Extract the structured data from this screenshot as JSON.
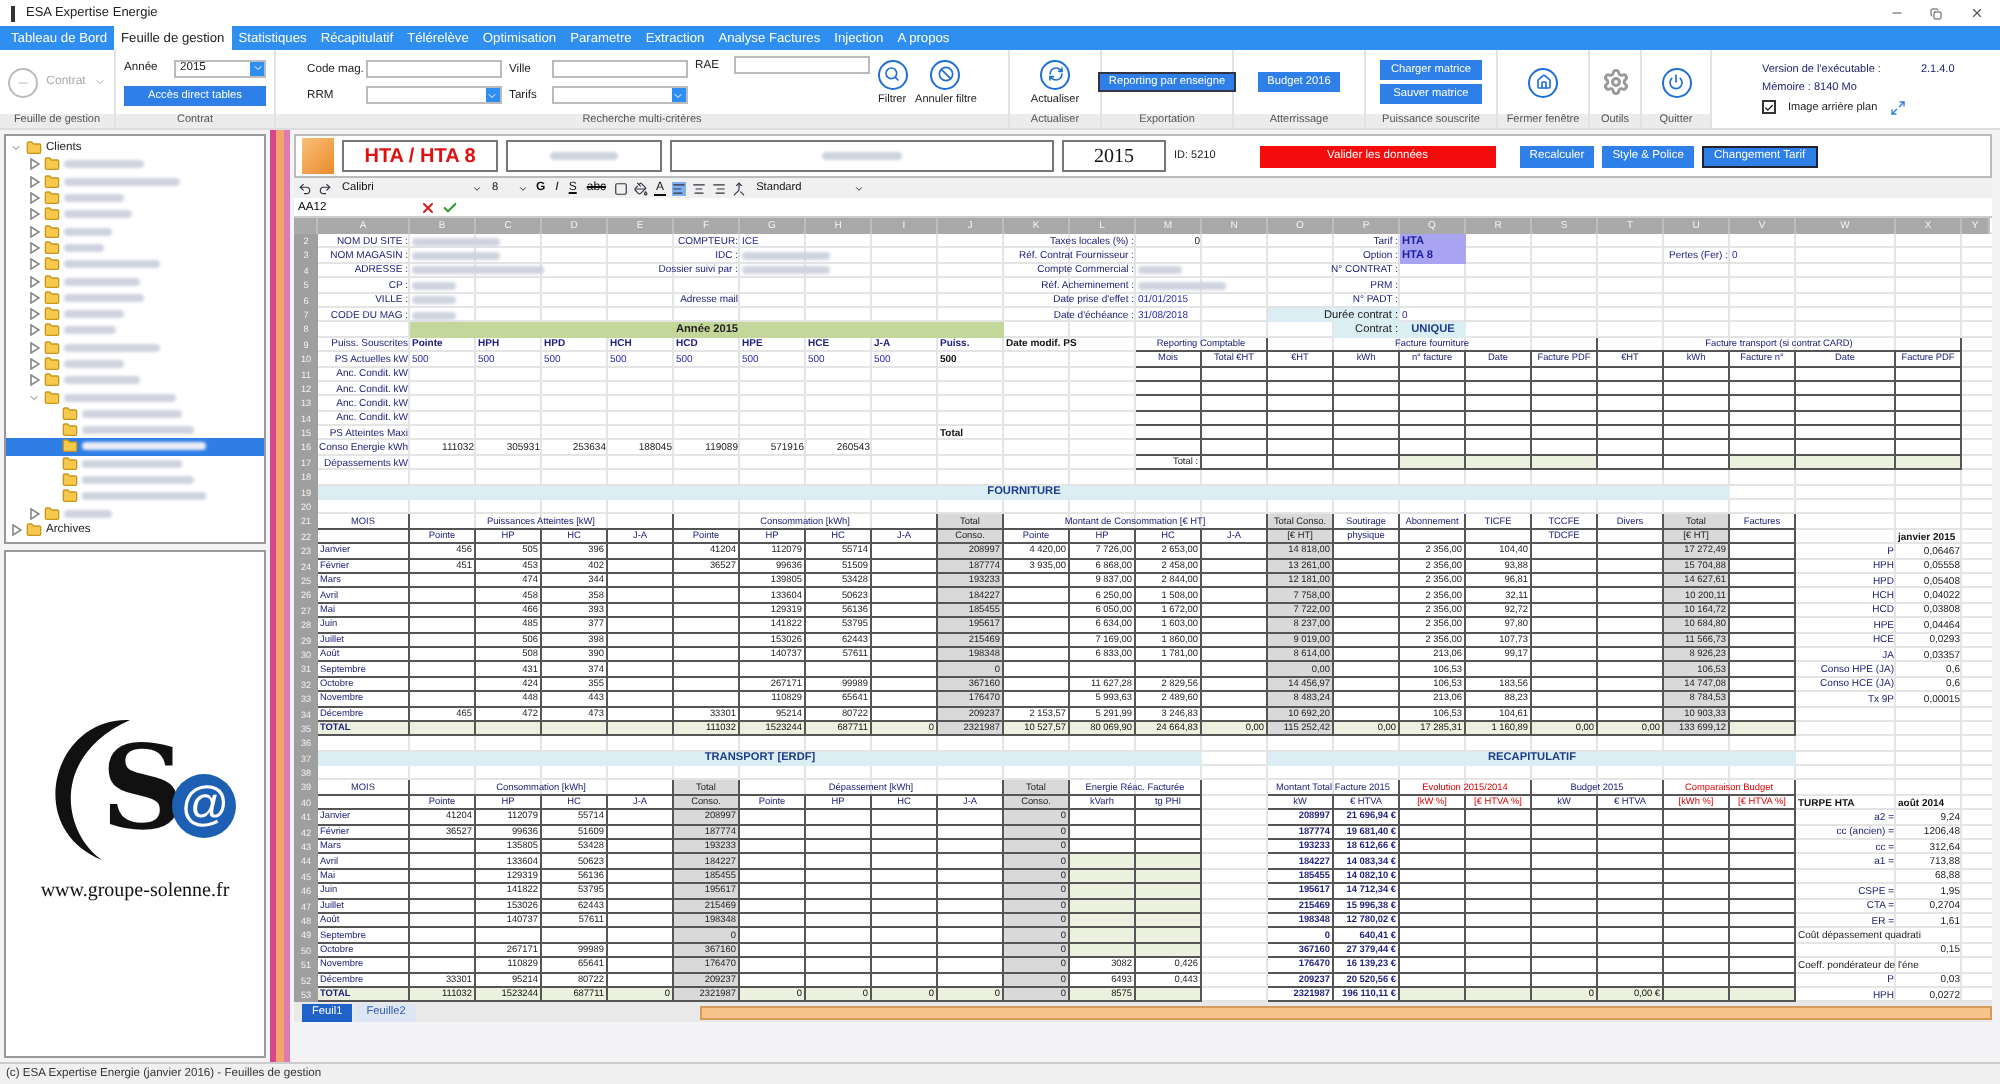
{
  "window": {
    "title": "ESA Expertise Energie"
  },
  "menu": [
    {
      "label": "Tableau de Bord",
      "selected": false
    },
    {
      "label": "Feuille de gestion",
      "selected": true
    },
    {
      "label": "Statistiques",
      "selected": false
    },
    {
      "label": "Récapitulatif",
      "selected": false
    },
    {
      "label": "Télérelève",
      "selected": false
    },
    {
      "label": "Optimisation",
      "selected": false
    },
    {
      "label": "Parametre",
      "selected": false
    },
    {
      "label": "Extraction",
      "selected": false
    },
    {
      "label": "Analyse Factures",
      "selected": false
    },
    {
      "label": "Injection",
      "selected": false
    },
    {
      "label": "A propos",
      "selected": false
    }
  ],
  "ribbon": {
    "groups": [
      {
        "label": "Feuille de gestion",
        "kind": "contract",
        "button": "Contrat",
        "disabled": true
      },
      {
        "label": "Contrat",
        "kind": "year",
        "field": {
          "label": "Année",
          "value": "2015"
        },
        "button": "Accès direct tables"
      },
      {
        "label": "Recherche multi-critères",
        "kind": "search",
        "fields": [
          {
            "label": "Code mag.",
            "kind": "text"
          },
          {
            "label": "RRM",
            "kind": "select"
          },
          {
            "label": "Ville",
            "kind": "text"
          },
          {
            "label": "Tarifs",
            "kind": "select"
          },
          {
            "label": "RAE",
            "kind": "text"
          }
        ],
        "buttons": [
          {
            "label": "Filtrer",
            "kind": "filter"
          },
          {
            "label": "Annuler filtre",
            "kind": "cancel-filter"
          }
        ]
      },
      {
        "label": "Actualiser",
        "kind": "icons",
        "buttons": [
          {
            "label": "Actualiser",
            "kind": "refresh"
          }
        ]
      },
      {
        "label": "Exportation",
        "kind": "texts",
        "buttons": [
          "Reporting par enseigne"
        ]
      },
      {
        "label": "Atterrissage",
        "kind": "texts",
        "buttons": [
          "Budget 2016"
        ]
      },
      {
        "label": "Puissance souscrite",
        "kind": "texts",
        "buttons": [
          "Charger matrice",
          "Sauver matrice"
        ]
      },
      {
        "label": "Fermer fenêtre",
        "kind": "icons",
        "buttons": [
          {
            "kind": "close-window"
          }
        ]
      },
      {
        "label": "Outils",
        "kind": "icons",
        "buttons": [
          {
            "kind": "tools"
          }
        ]
      },
      {
        "label": "Quitter",
        "kind": "icons",
        "buttons": [
          {
            "kind": "quit"
          }
        ]
      }
    ],
    "info": {
      "version_label": "Version de l'exécutable :",
      "version": "2.1.4.0",
      "memory": "Mémoire : 8140 Mo",
      "checkbox": {
        "label": "Image arrière plan",
        "checked": true
      }
    }
  },
  "tree": [
    {
      "label": "Clients",
      "expanded": true,
      "selected": false,
      "children": [
        {
          "expanded": false,
          "selected": false
        },
        {
          "expanded": false,
          "selected": false
        },
        {
          "expanded": false,
          "selected": false
        },
        {
          "expanded": false,
          "selected": false
        },
        {
          "expanded": false,
          "selected": false
        },
        {
          "expanded": false,
          "selected": false
        },
        {
          "expanded": false,
          "selected": false
        },
        {
          "expanded": false,
          "selected": false
        },
        {
          "expanded": false,
          "selected": false
        },
        {
          "expanded": false,
          "selected": false
        },
        {
          "expanded": false,
          "selected": false
        },
        {
          "expanded": false,
          "selected": false
        },
        {
          "expanded": false,
          "selected": false
        },
        {
          "expanded": false,
          "selected": false
        },
        {
          "expanded": true,
          "selected": false,
          "children": [
            {
              "selected": false
            },
            {
              "selected": false
            },
            {
              "selected": true
            },
            {
              "selected": false
            },
            {
              "selected": false
            },
            {
              "selected": false
            }
          ]
        },
        {
          "expanded": false,
          "selected": false
        }
      ]
    },
    {
      "label": "Archives",
      "expanded": false,
      "selected": false
    }
  ],
  "logo": {
    "letter": "S",
    "mark": "@",
    "url": "www.groupe-solenne.fr"
  },
  "sheet_header": {
    "fields": [
      {
        "kind": "title",
        "text": "HTA / HTA 8"
      },
      {
        "kind": "redacted"
      },
      {
        "kind": "redacted-wide"
      },
      {
        "kind": "year",
        "text": "2015"
      }
    ],
    "id": "ID: 5210",
    "buttons": [
      {
        "label": "Valider les données",
        "kind": "danger"
      },
      {
        "label": "Recalculer",
        "kind": "primary"
      },
      {
        "label": "Style & Police",
        "kind": "primary"
      },
      {
        "label": "Changement Tarif",
        "kind": "outlined"
      }
    ]
  },
  "format_bar": {
    "font": "Calibri",
    "size": "8",
    "bold": "G",
    "italic": "I",
    "underline": "S",
    "strike": "abc",
    "font_color": "A",
    "number_format": "Standard",
    "cell_ref": "AA12"
  },
  "columns": [
    "A",
    "B",
    "C",
    "D",
    "E",
    "F",
    "G",
    "H",
    "I",
    "J",
    "K",
    "L",
    "M",
    "N",
    "O",
    "P",
    "Q",
    "R",
    "S",
    "T",
    "U",
    "V",
    "W",
    "X",
    "Y"
  ],
  "rows": [
    {
      "n": "2",
      "cells": {
        "A": {
          "text": "NOM DU SITE :",
          "kind": "label"
        },
        "B-C": {
          "kind": "redacted"
        },
        "F": {
          "text": "COMPTEUR:",
          "kind": "label"
        },
        "G": {
          "text": "ICE",
          "kind": "value"
        },
        "K-L": {
          "text": "Taxes locales (%) :",
          "kind": "label"
        },
        "M": {
          "text": "0",
          "kind": "num"
        },
        "P": {
          "text": "Tarif :",
          "kind": "label"
        },
        "Q": {
          "text": "HTA",
          "kind": "highlight"
        }
      }
    },
    {
      "n": "3",
      "cells": {
        "A": {
          "text": "NOM MAGASIN :",
          "kind": "label"
        },
        "B-C": {
          "kind": "redacted"
        },
        "F": {
          "text": "IDC :",
          "kind": "label"
        },
        "G-H": {
          "kind": "redacted"
        },
        "K-L": {
          "text": "Réf. Contrat Fournisseur :",
          "kind": "label"
        },
        "P": {
          "text": "Option :",
          "kind": "label"
        },
        "Q": {
          "text": "HTA 8",
          "kind": "highlight"
        },
        "T-U": {
          "text": "Pertes (Fer) :",
          "kind": "label"
        },
        "V": {
          "text": "0",
          "kind": "value"
        }
      }
    },
    {
      "n": "4",
      "cells": {
        "A": {
          "text": "ADRESSE :",
          "kind": "label"
        },
        "B-D": {
          "kind": "redacted"
        },
        "E-F": {
          "text": "Dossier suivi par :",
          "kind": "label"
        },
        "G-H": {
          "kind": "redacted"
        },
        "K-L": {
          "text": "Compte Commercial :",
          "kind": "label"
        },
        "M": {
          "kind": "redacted"
        },
        "P": {
          "text": "N° CONTRAT :",
          "kind": "label"
        }
      }
    },
    {
      "n": "5",
      "cells": {
        "A": {
          "text": "CP :",
          "kind": "label"
        },
        "B": {
          "kind": "redacted"
        },
        "K-L": {
          "text": "Réf. Acheminement :",
          "kind": "label"
        },
        "M-N": {
          "kind": "redacted"
        },
        "P": {
          "text": "PRM :",
          "kind": "label"
        }
      }
    },
    {
      "n": "6",
      "cells": {
        "A": {
          "text": "VILLE :",
          "kind": "label"
        },
        "B": {
          "kind": "redacted"
        },
        "F": {
          "text": "Adresse mail",
          "kind": "label"
        },
        "K-L": {
          "text": "Date prise d'effet :",
          "kind": "label"
        },
        "M": {
          "text": "01/01/2015",
          "kind": "value"
        },
        "P": {
          "text": "N° PADT :",
          "kind": "label"
        }
      }
    },
    {
      "n": "7",
      "cells": {
        "A": {
          "text": "CODE DU MAG :",
          "kind": "label"
        },
        "B": {
          "kind": "redacted"
        },
        "K-L": {
          "text": "Date d'échéance :",
          "kind": "label"
        },
        "M": {
          "text": "31/08/2018",
          "kind": "value"
        },
        "O-P": {
          "text": "Durée contrat :",
          "kind": "light"
        },
        "Q": {
          "text": "0",
          "kind": "value"
        }
      }
    },
    {
      "n": "8",
      "cells": {
        "B-J": {
          "text": "Année",
          "year": "2015",
          "kind": "band-green"
        },
        "P": {
          "text": "Contrat :",
          "kind": "light"
        },
        "Q": {
          "text": "UNIQUE",
          "kind": "light-bold"
        }
      }
    },
    {
      "n": "9",
      "kind": "colhead",
      "cells": {
        "A": {
          "text": "Puiss. Souscrites",
          "kind": "label"
        },
        "B": "Pointe",
        "C": "HPH",
        "D": "HPD",
        "E": "HCH",
        "F": "HCD",
        "G": "HPE",
        "H": "HCE",
        "I": "J-A",
        "J": "Puiss.",
        "K-L": {
          "text": "Date modif. PS",
          "kind": "bold"
        },
        "M-N": {
          "text": "Reporting Comptable",
          "kind": "head"
        },
        "O-S": {
          "text": "Facture fourniture",
          "kind": "head"
        },
        "T-X": {
          "text": "Facture transport (si contrat CARD)",
          "kind": "head"
        }
      }
    },
    {
      "n": "10",
      "kind": "head",
      "cells": {
        "A": {
          "text": "PS Actuelles kW",
          "kind": "label"
        },
        "B": {
          "text": "500",
          "kind": "value"
        },
        "C": {
          "text": "500",
          "kind": "value"
        },
        "D": {
          "text": "500",
          "kind": "value"
        },
        "E": {
          "text": "500",
          "kind": "value"
        },
        "F": {
          "text": "500",
          "kind": "value"
        },
        "G": {
          "text": "500",
          "kind": "value"
        },
        "H": {
          "text": "500",
          "kind": "value"
        },
        "I": {
          "text": "500",
          "kind": "value"
        },
        "J": {
          "text": "500",
          "kind": "bold"
        },
        "M": "Mois",
        "N": "Total €HT",
        "O": "€HT",
        "P": "kWh",
        "Q": "n° facture",
        "R": "Date",
        "S": "Facture PDF",
        "T": "€HT",
        "U": "kWh",
        "V": "Facture n°",
        "W": "Date",
        "X": "Facture PDF"
      }
    },
    {
      "n": "11",
      "cells": {
        "A": {
          "text": "Anc. Condit. kW",
          "kind": "label"
        },
        "M-X": {
          "kind": "cell"
        }
      }
    },
    {
      "n": "12",
      "cells": {
        "A": {
          "text": "Anc. Condit. kW",
          "kind": "label"
        },
        "M-X": {
          "kind": "cell"
        }
      }
    },
    {
      "n": "13",
      "cells": {
        "A": {
          "text": "Anc. Condit. kW",
          "kind": "label"
        },
        "M-X": {
          "kind": "cell"
        }
      }
    },
    {
      "n": "14",
      "cells": {
        "A": {
          "text": "Anc. Condit. kW",
          "kind": "label"
        },
        "M-X": {
          "kind": "cell"
        }
      }
    },
    {
      "n": "15",
      "cells": {
        "A": {
          "text": "PS Atteintes Maxi",
          "kind": "label"
        },
        "J": {
          "text": "Total",
          "kind": "bold"
        },
        "M-X": {
          "kind": "cell"
        }
      }
    },
    {
      "n": "16",
      "kind": "num",
      "cells": {
        "A": {
          "text": "Conso Energie kWh",
          "kind": "label"
        },
        "B": "111032",
        "C": "305931",
        "D": "253634",
        "E": "188045",
        "F": "119089",
        "G": "571916",
        "H": "260543",
        "M-X": {
          "kind": "cell"
        }
      }
    },
    {
      "n": "17",
      "cells": {
        "A": {
          "text": "Dépassements kW",
          "kind": "label"
        },
        "M-X": {
          "kind": "cell"
        },
        "Q-S": {
          "kind": "sum"
        },
        "V-X": {
          "kind": "sum"
        },
        "M": {
          "text": "Total :",
          "kind": "cell"
        }
      }
    },
    {
      "n": "18",
      "cells": {}
    },
    {
      "n": "19",
      "cells": {
        "A-U": {
          "text": "FOURNITURE",
          "kind": "band-blue"
        }
      }
    },
    {
      "n": "20",
      "cells": {}
    },
    {
      "n": "21",
      "kind": "head",
      "cells": {
        "A-V": {
          "kind": "head"
        },
        "A": "MOIS",
        "B-E": "Puissances Atteintes [kW]",
        "F-I": "Consommation [kWh]",
        "J": {
          "text": "Total",
          "kind": "head-gray"
        },
        "K-N": "Montant de Consommation [€ HT]",
        "O": {
          "text": "Total Conso.",
          "kind": "head-gray"
        },
        "P": "Soutirage",
        "Q": "Abonnement",
        "R": "TICFE",
        "S": "TCCFE",
        "T": "Divers",
        "U": {
          "text": "Total",
          "kind": "head-gray"
        },
        "V": "Factures"
      }
    },
    {
      "n": "22",
      "kind": "head",
      "cells": {
        "A-V": {
          "kind": "head"
        },
        "B": "Pointe",
        "C": "HP",
        "D": "HC",
        "E": "J-A",
        "F": "Pointe",
        "G": "HP",
        "H": "HC",
        "I": "J-A",
        "J": {
          "text": "Conso.",
          "kind": "head-gray"
        },
        "K": "Pointe",
        "L": "HP",
        "M": "HC",
        "N": "J-A",
        "O": {
          "text": "[€ HT]",
          "kind": "head-gray"
        },
        "P": "physique",
        "S": "TDCFE",
        "U": {
          "text": "[€ HT]",
          "kind": "head-gray"
        },
        "X": {
          "text": "janvier 2015",
          "kind": "bold"
        }
      }
    },
    {
      "n": "23",
      "kind": "cell",
      "cells": {
        "A-V": {
          "kind": "cell"
        },
        "A": {
          "text": "Janvier",
          "kind": "month"
        },
        "B": "456",
        "C": "505",
        "D": "396",
        "F": "41204",
        "G": "112079",
        "H": "55714",
        "J": {
          "text": "208997",
          "kind": "total"
        },
        "K": "4 420,00",
        "L": "7 726,00",
        "M": "2 653,00",
        "O": {
          "text": "14 818,00",
          "kind": "total"
        },
        "Q": "2 356,00",
        "R": "104,40",
        "U": {
          "text": "17 272,49",
          "kind": "total"
        },
        "W": {
          "text": "P",
          "kind": "label"
        },
        "X": {
          "text": "0,06467",
          "kind": "num"
        }
      }
    },
    {
      "n": "24",
      "kind": "cell",
      "cells": {
        "A-V": {
          "kind": "cell"
        },
        "A": {
          "text": "Février",
          "kind": "month"
        },
        "B": "451",
        "C": "453",
        "D": "402",
        "F": "36527",
        "G": "99636",
        "H": "51509",
        "J": {
          "text": "187774",
          "kind": "total"
        },
        "K": "3 935,00",
        "L": "6 868,00",
        "M": "2 458,00",
        "O": {
          "text": "13 261,00",
          "kind": "total"
        },
        "Q": "2 356,00",
        "R": "93,88",
        "U": {
          "text": "15 704,88",
          "kind": "total"
        },
        "W": {
          "text": "HPH",
          "kind": "label"
        },
        "X": {
          "text": "0,05558",
          "kind": "num"
        }
      }
    },
    {
      "n": "25",
      "kind": "cell",
      "cells": {
        "A-V": {
          "kind": "cell"
        },
        "A": {
          "text": "Mars",
          "kind": "month"
        },
        "C": "474",
        "D": "344",
        "G": "139805",
        "H": "53428",
        "J": {
          "text": "193233",
          "kind": "total"
        },
        "L": "9 837,00",
        "M": "2 844,00",
        "O": {
          "text": "12 181,00",
          "kind": "total"
        },
        "Q": "2 356,00",
        "R": "96,81",
        "U": {
          "text": "14 627,61",
          "kind": "total"
        },
        "W": {
          "text": "HPD",
          "kind": "label"
        },
        "X": {
          "text": "0,05408",
          "kind": "num"
        }
      }
    },
    {
      "n": "26",
      "kind": "cell",
      "cells": {
        "A-V": {
          "kind": "cell"
        },
        "A": {
          "text": "Avril",
          "kind": "month"
        },
        "C": "458",
        "D": "358",
        "G": "133604",
        "H": "50623",
        "J": {
          "text": "184227",
          "kind": "total"
        },
        "L": "6 250,00",
        "M": "1 508,00",
        "O": {
          "text": "7 758,00",
          "kind": "total"
        },
        "Q": "2 356,00",
        "R": "32,11",
        "U": {
          "text": "10 200,11",
          "kind": "total"
        },
        "W": {
          "text": "HCH",
          "kind": "label"
        },
        "X": {
          "text": "0,04022",
          "kind": "num"
        }
      }
    },
    {
      "n": "27",
      "kind": "cell",
      "cells": {
        "A-V": {
          "kind": "cell"
        },
        "A": {
          "text": "Mai",
          "kind": "month"
        },
        "C": "466",
        "D": "393",
        "G": "129319",
        "H": "56136",
        "J": {
          "text": "185455",
          "kind": "total"
        },
        "L": "6 050,00",
        "M": "1 672,00",
        "O": {
          "text": "7 722,00",
          "kind": "total"
        },
        "Q": "2 356,00",
        "R": "92,72",
        "U": {
          "text": "10 164,72",
          "kind": "total"
        },
        "W": {
          "text": "HCD",
          "kind": "label"
        },
        "X": {
          "text": "0,03808",
          "kind": "num"
        }
      }
    },
    {
      "n": "28",
      "kind": "cell",
      "cells": {
        "A-V": {
          "kind": "cell"
        },
        "A": {
          "text": "Juin",
          "kind": "month"
        },
        "C": "485",
        "D": "377",
        "G": "141822",
        "H": "53795",
        "J": {
          "text": "195617",
          "kind": "total"
        },
        "L": "6 634,00",
        "M": "1 603,00",
        "O": {
          "text": "8 237,00",
          "kind": "total"
        },
        "Q": "2 356,00",
        "R": "97,80",
        "U": {
          "text": "10 684,80",
          "kind": "total"
        },
        "W": {
          "text": "HPE",
          "kind": "label"
        },
        "X": {
          "text": "0,04464",
          "kind": "num"
        }
      }
    },
    {
      "n": "29",
      "kind": "cell",
      "cells": {
        "A-V": {
          "kind": "cell"
        },
        "A": {
          "text": "Juillet",
          "kind": "month"
        },
        "C": "506",
        "D": "398",
        "G": "153026",
        "H": "62443",
        "J": {
          "text": "215469",
          "kind": "total"
        },
        "L": "7 169,00",
        "M": "1 860,00",
        "O": {
          "text": "9 019,00",
          "kind": "total"
        },
        "Q": "2 356,00",
        "R": "107,73",
        "U": {
          "text": "11 566,73",
          "kind": "total"
        },
        "W": {
          "text": "HCE",
          "kind": "label"
        },
        "X": {
          "text": "0,0293",
          "kind": "num"
        }
      }
    },
    {
      "n": "30",
      "kind": "cell",
      "cells": {
        "A-V": {
          "kind": "cell"
        },
        "A": {
          "text": "Août",
          "kind": "month"
        },
        "C": "508",
        "D": "390",
        "G": "140737",
        "H": "57611",
        "J": {
          "text": "198348",
          "kind": "total"
        },
        "L": "6 833,00",
        "M": "1 781,00",
        "O": {
          "text": "8 614,00",
          "kind": "total"
        },
        "Q": "213,06",
        "R": "99,17",
        "U": {
          "text": "8 926,23",
          "kind": "total"
        },
        "W": {
          "text": "JA",
          "kind": "label"
        },
        "X": {
          "text": "0,03357",
          "kind": "num"
        }
      }
    },
    {
      "n": "31",
      "kind": "cell",
      "cells": {
        "A-V": {
          "kind": "cell"
        },
        "A": {
          "text": "Septembre",
          "kind": "month"
        },
        "C": "431",
        "D": "374",
        "J": {
          "text": "0",
          "kind": "total"
        },
        "O": {
          "text": "0,00",
          "kind": "total"
        },
        "Q": "106,53",
        "U": {
          "text": "106,53",
          "kind": "total"
        },
        "W": {
          "text": "Conso HPE (JA)",
          "kind": "label"
        },
        "X": {
          "text": "0,6",
          "kind": "num"
        }
      }
    },
    {
      "n": "32",
      "kind": "cell",
      "cells": {
        "A-V": {
          "kind": "cell"
        },
        "A": {
          "text": "Octobre",
          "kind": "month"
        },
        "C": "424",
        "D": "355",
        "G": "267171",
        "H": "99989",
        "J": {
          "text": "367160",
          "kind": "total"
        },
        "L": "11 627,28",
        "M": "2 829,56",
        "O": {
          "text": "14 456,97",
          "kind": "total"
        },
        "Q": "106,53",
        "R": "183,56",
        "U": {
          "text": "14 747,08",
          "kind": "total"
        },
        "W": {
          "text": "Conso HCE (JA)",
          "kind": "label"
        },
        "X": {
          "text": "0,6",
          "kind": "num"
        }
      }
    },
    {
      "n": "33",
      "kind": "cell",
      "cells": {
        "A-V": {
          "kind": "cell"
        },
        "A": {
          "text": "Novembre",
          "kind": "month"
        },
        "C": "448",
        "D": "443",
        "G": "110829",
        "H": "65641",
        "J": {
          "text": "176470",
          "kind": "total"
        },
        "L": "5 993,63",
        "M": "2 489,60",
        "O": {
          "text": "8 483,24",
          "kind": "total"
        },
        "Q": "213,06",
        "R": "88,23",
        "U": {
          "text": "8 784,53",
          "kind": "total"
        },
        "W": {
          "text": "Tx 9P",
          "kind": "label"
        },
        "X": {
          "text": "0,00015",
          "kind": "num"
        }
      }
    },
    {
      "n": "34",
      "kind": "cell",
      "cells": {
        "A-V": {
          "kind": "cell"
        },
        "A": {
          "text": "Décembre",
          "kind": "month"
        },
        "B": "465",
        "C": "472",
        "D": "473",
        "F": "33301",
        "G": "95214",
        "H": "80722",
        "J": {
          "text": "209237",
          "kind": "total"
        },
        "K": "2 153,57",
        "L": "5 291,99",
        "M": "3 246,83",
        "O": {
          "text": "10 692,20",
          "kind": "total"
        },
        "Q": "106,53",
        "R": "104,61",
        "U": {
          "text": "10 903,33",
          "kind": "total"
        }
      }
    },
    {
      "n": "35",
      "kind": "sum",
      "cells": {
        "A-V": {
          "kind": "sum"
        },
        "A": {
          "text": "TOTAL",
          "kind": "sum-label"
        },
        "F": "111032",
        "G": "1523244",
        "H": "687711",
        "I": "0",
        "J": {
          "text": "2321987",
          "kind": "total"
        },
        "K": "10 527,57",
        "L": "80 069,90",
        "M": "24 664,83",
        "N": "0,00",
        "O": {
          "text": "115 252,42",
          "kind": "total"
        },
        "P": "0,00",
        "Q": "17 285,31",
        "R": "1 160,89",
        "S": "0,00",
        "T": "0,00",
        "U": {
          "text": "133 699,12",
          "kind": "total"
        }
      }
    },
    {
      "n": "36",
      "cells": {}
    },
    {
      "n": "37",
      "cells": {
        "A-M": {
          "text": "TRANSPORT [ERDF]",
          "kind": "band-blue"
        },
        "O-V": {
          "text": "RECAPITULATIF",
          "kind": "band-blue"
        }
      }
    },
    {
      "n": "38",
      "cells": {}
    },
    {
      "n": "39",
      "kind": "head",
      "cells": {
        "A-M": {
          "kind": "head"
        },
        "O-V": {
          "kind": "head"
        },
        "A": "MOIS",
        "B-E": "Consommation [kWh]",
        "F": {
          "text": "Total",
          "kind": "head-gray"
        },
        "G-J": "Dépassement [kWh]",
        "K": {
          "text": "Total",
          "kind": "head-gray"
        },
        "L-M": "Energie Réac. Facturée",
        "O-P": "Montant Total Facture 2015",
        "Q-R": {
          "text": "Evolution 2015/2014",
          "kind": "head-red"
        },
        "S-T": "Budget 2015",
        "U-V": {
          "text": "Comparaison Budget",
          "kind": "head-red"
        }
      }
    },
    {
      "n": "40",
      "kind": "head",
      "cells": {
        "A-M": {
          "kind": "head"
        },
        "B": "Pointe",
        "C": "HP",
        "D": "HC",
        "E": "J-A",
        "F": {
          "text": "Conso.",
          "kind": "head-gray"
        },
        "G": "Pointe",
        "H": "HP",
        "I": "HC",
        "J": "J-A",
        "K": {
          "text": "Conso.",
          "kind": "head-gray"
        },
        "L": "kVarh",
        "M": "tg PHI",
        "O": "kW",
        "P": "€ HTVA",
        "Q": {
          "text": "[kW %]",
          "kind": "head-red"
        },
        "R": {
          "text": "[€ HTVA %]",
          "kind": "head-red"
        },
        "S": "kW",
        "T": "€ HTVA",
        "U": {
          "text": "[kWh %]",
          "kind": "head-red"
        },
        "V": {
          "text": "[€ HTVA %]",
          "kind": "head-red"
        },
        "W": {
          "text": "TURPE HTA",
          "kind": "bold"
        },
        "X": {
          "text": "août 2014",
          "kind": "bold"
        }
      }
    },
    {
      "n": "41",
      "kind": "cell",
      "cells": {
        "A-M": {
          "kind": "cell"
        },
        "O-V": {
          "kind": "cell"
        },
        "A": {
          "text": "Janvier",
          "kind": "month"
        },
        "B": "41204",
        "C": "112079",
        "D": "55714",
        "F": {
          "text": "208997",
          "kind": "total"
        },
        "K": {
          "text": "0",
          "kind": "total"
        },
        "O": {
          "text": "208997",
          "kind": "cell-bold"
        },
        "P": {
          "text": "21 696,94 €",
          "kind": "cell-bold"
        },
        "W": {
          "text": "a2 =",
          "kind": "label"
        },
        "X": {
          "text": "9,24",
          "kind": "num"
        }
      }
    },
    {
      "n": "42",
      "kind": "cell",
      "cells": {
        "A-M": {
          "kind": "cell"
        },
        "O-V": {
          "kind": "cell"
        },
        "A": {
          "text": "Février",
          "kind": "month"
        },
        "B": "36527",
        "C": "99636",
        "D": "51609",
        "F": {
          "text": "187774",
          "kind": "total"
        },
        "K": {
          "text": "0",
          "kind": "total"
        },
        "O": {
          "text": "187774",
          "kind": "cell-bold"
        },
        "P": {
          "text": "19 681,40 €",
          "kind": "cell-bold"
        },
        "W": {
          "text": "cc (ancien) =",
          "kind": "label"
        },
        "X": {
          "text": "1206,48",
          "kind": "num"
        }
      }
    },
    {
      "n": "43",
      "kind": "cell",
      "cells": {
        "A-M": {
          "kind": "cell"
        },
        "O-V": {
          "kind": "cell"
        },
        "A": {
          "text": "Mars",
          "kind": "month"
        },
        "C": "135805",
        "D": "53428",
        "F": {
          "text": "193233",
          "kind": "total"
        },
        "K": {
          "text": "0",
          "kind": "total"
        },
        "O": {
          "text": "193233",
          "kind": "cell-bold"
        },
        "P": {
          "text": "18 612,66 €",
          "kind": "cell-bold"
        },
        "W": {
          "text": "cc =",
          "kind": "label"
        },
        "X": {
          "text": "312,64",
          "kind": "num"
        }
      }
    },
    {
      "n": "44",
      "kind": "cell",
      "cells": {
        "A-M": {
          "kind": "cell"
        },
        "O-V": {
          "kind": "cell"
        },
        "L-M": {
          "kind": "sum"
        },
        "A": {
          "text": "Avril",
          "kind": "month"
        },
        "C": "133604",
        "D": "50623",
        "F": {
          "text": "184227",
          "kind": "total"
        },
        "K": {
          "text": "0",
          "kind": "total"
        },
        "O": {
          "text": "184227",
          "kind": "cell-bold"
        },
        "P": {
          "text": "14 083,34 €",
          "kind": "cell-bold"
        },
        "W": {
          "text": "a1 =",
          "kind": "label"
        },
        "X": {
          "text": "713,88",
          "kind": "num"
        }
      }
    },
    {
      "n": "45",
      "kind": "cell",
      "cells": {
        "A-M": {
          "kind": "cell"
        },
        "O-V": {
          "kind": "cell"
        },
        "L-M": {
          "kind": "sum"
        },
        "A": {
          "text": "Mai",
          "kind": "month"
        },
        "C": "129319",
        "D": "56136",
        "F": {
          "text": "185455",
          "kind": "total"
        },
        "K": {
          "text": "0",
          "kind": "total"
        },
        "O": {
          "text": "185455",
          "kind": "cell-bold"
        },
        "P": {
          "text": "14 082,10 €",
          "kind": "cell-bold"
        },
        "X": {
          "text": "68,88",
          "kind": "num"
        }
      }
    },
    {
      "n": "46",
      "kind": "cell",
      "cells": {
        "A-M": {
          "kind": "cell"
        },
        "O-V": {
          "kind": "cell"
        },
        "L-M": {
          "kind": "sum"
        },
        "A": {
          "text": "Juin",
          "kind": "month"
        },
        "C": "141822",
        "D": "53795",
        "F": {
          "text": "195617",
          "kind": "total"
        },
        "K": {
          "text": "0",
          "kind": "total"
        },
        "O": {
          "text": "195617",
          "kind": "cell-bold"
        },
        "P": {
          "text": "14 712,34 €",
          "kind": "cell-bold"
        },
        "W": {
          "text": "CSPE =",
          "kind": "label"
        },
        "X": {
          "text": "1,95",
          "kind": "num"
        }
      }
    },
    {
      "n": "47",
      "kind": "cell",
      "cells": {
        "A-M": {
          "kind": "cell"
        },
        "O-V": {
          "kind": "cell"
        },
        "L-M": {
          "kind": "sum"
        },
        "A": {
          "text": "Juillet",
          "kind": "month"
        },
        "C": "153026",
        "D": "62443",
        "F": {
          "text": "215469",
          "kind": "total"
        },
        "K": {
          "text": "0",
          "kind": "total"
        },
        "O": {
          "text": "215469",
          "kind": "cell-bold"
        },
        "P": {
          "text": "15 996,38 €",
          "kind": "cell-bold"
        },
        "W": {
          "text": "CTA =",
          "kind": "label"
        },
        "X": {
          "text": "0,2704",
          "kind": "num"
        }
      }
    },
    {
      "n": "48",
      "kind": "cell",
      "cells": {
        "A-M": {
          "kind": "cell"
        },
        "O-V": {
          "kind": "cell"
        },
        "L-M": {
          "kind": "sum"
        },
        "A": {
          "text": "Août",
          "kind": "month"
        },
        "C": "140737",
        "D": "57611",
        "F": {
          "text": "198348",
          "kind": "total"
        },
        "K": {
          "text": "0",
          "kind": "total"
        },
        "O": {
          "text": "198348",
          "kind": "cell-bold"
        },
        "P": {
          "text": "12 780,02 €",
          "kind": "cell-bold"
        },
        "W": {
          "text": "ER =",
          "kind": "label"
        },
        "X": {
          "text": "1,61",
          "kind": "num"
        }
      }
    },
    {
      "n": "49",
      "cells": {
        "A-M": {
          "kind": "cell"
        },
        "O-V": {
          "kind": "cell"
        },
        "L-M": {
          "kind": "sum"
        },
        "A": {
          "text": "Septembre",
          "kind": "month"
        },
        "F": {
          "text": "0",
          "kind": "total"
        },
        "K": {
          "text": "0",
          "kind": "total"
        },
        "O": {
          "text": "0",
          "kind": "cell-bold"
        },
        "P": {
          "text": "640,41 €",
          "kind": "cell-bold"
        },
        "W-Y": {
          "text": "Coût dépassement quadrati",
          "kind": "text"
        }
      }
    },
    {
      "n": "50",
      "kind": "cell",
      "cells": {
        "A-M": {
          "kind": "cell"
        },
        "O-V": {
          "kind": "cell"
        },
        "L-M": {
          "kind": "sum"
        },
        "A": {
          "text": "Octobre",
          "kind": "month"
        },
        "C": "267171",
        "D": "99989",
        "F": {
          "text": "367160",
          "kind": "total"
        },
        "K": {
          "text": "0",
          "kind": "total"
        },
        "O": {
          "text": "367160",
          "kind": "cell-bold"
        },
        "P": {
          "text": "27 379,44 €",
          "kind": "cell-bold"
        },
        "X": {
          "text": "0,15",
          "kind": "num"
        }
      }
    },
    {
      "n": "51",
      "kind": "cell",
      "cells": {
        "A-M": {
          "kind": "cell"
        },
        "O-V": {
          "kind": "cell"
        },
        "A": {
          "text": "Novembre",
          "kind": "month"
        },
        "C": "110829",
        "D": "65641",
        "F": {
          "text": "176470",
          "kind": "total"
        },
        "K": {
          "text": "0",
          "kind": "total"
        },
        "L": "3082",
        "M": "0,426",
        "O": {
          "text": "176470",
          "kind": "cell-bold"
        },
        "P": {
          "text": "16 139,23 €",
          "kind": "cell-bold"
        },
        "W-Y": {
          "text": "Coeff. pondérateur de l'éne",
          "kind": "text"
        }
      }
    },
    {
      "n": "52",
      "kind": "cell",
      "cells": {
        "A-M": {
          "kind": "cell"
        },
        "O-V": {
          "kind": "cell"
        },
        "A": {
          "text": "Décembre",
          "kind": "month"
        },
        "B": "33301",
        "C": "95214",
        "D": "80722",
        "F": {
          "text": "209237",
          "kind": "total"
        },
        "K": {
          "text": "0",
          "kind": "total"
        },
        "L": "6493",
        "M": "0,443",
        "O": {
          "text": "209237",
          "kind": "cell-bold"
        },
        "P": {
          "text": "20 520,56 €",
          "kind": "cell-bold"
        },
        "W": {
          "text": "P",
          "kind": "label"
        },
        "X": {
          "text": "0,03",
          "kind": "num"
        }
      }
    },
    {
      "n": "53",
      "kind": "sum",
      "cells": {
        "A-M": {
          "kind": "sum"
        },
        "O-V": {
          "kind": "sum"
        },
        "A": {
          "text": "TOTAL",
          "kind": "sum-label"
        },
        "B": "111032",
        "C": "1523244",
        "D": "687711",
        "E": "0",
        "F": {
          "text": "2321987",
          "kind": "total"
        },
        "G": "0",
        "H": "0",
        "I": "0",
        "J": "0",
        "K": {
          "text": "0",
          "kind": "total"
        },
        "L": "8575",
        "O": {
          "text": "2321987",
          "kind": "cell-bold"
        },
        "P": {
          "text": "196 110,11 €",
          "kind": "cell-bold"
        },
        "S": "0",
        "T": "0,00 €",
        "W": {
          "text": "HPH",
          "kind": "label"
        },
        "X": {
          "text": "0,0272",
          "kind": "num"
        }
      }
    }
  ],
  "sheet_tabs": [
    {
      "label": "Feuil1",
      "selected": true
    },
    {
      "label": "Feuille2",
      "selected": false
    }
  ],
  "status_bar": "(c) ESA Expertise Energie (janvier 2016) - Feuilles de gestion"
}
